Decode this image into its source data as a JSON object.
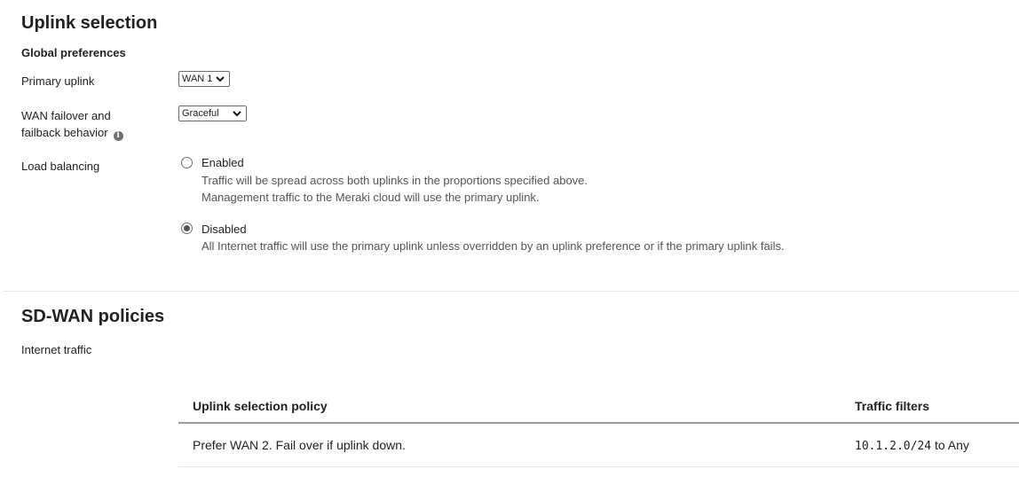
{
  "uplink_selection": {
    "title": "Uplink selection",
    "global_preferences": {
      "heading": "Global preferences",
      "primary_uplink": {
        "label": "Primary uplink",
        "value": "WAN 1"
      },
      "failover": {
        "label_line1": "WAN failover and",
        "label_line2": "failback behavior",
        "value": "Graceful",
        "info_icon": "info-icon"
      },
      "load_balancing": {
        "label": "Load balancing",
        "options": [
          {
            "label": "Enabled",
            "checked": false,
            "desc1": "Traffic will be spread across both uplinks in the proportions specified above.",
            "desc2": "Management traffic to the Meraki cloud will use the primary uplink."
          },
          {
            "label": "Disabled",
            "checked": true,
            "desc1": "All Internet traffic will use the primary uplink unless overridden by an uplink preference or if the primary uplink fails."
          }
        ]
      }
    }
  },
  "sdwan": {
    "title": "SD-WAN policies",
    "internet_traffic_label": "Internet traffic",
    "table": {
      "headers": [
        "Uplink selection policy",
        "Traffic filters"
      ],
      "rows": [
        {
          "policy": "Prefer WAN 2. Fail over if uplink down.",
          "filter_code": "10.1.2.0/24",
          "filter_text": " to Any"
        }
      ]
    }
  },
  "colors": {
    "text": "#222222",
    "muted": "#555555",
    "divider": "#e6e6e6",
    "table_header_rule": "#9a9a9a"
  }
}
